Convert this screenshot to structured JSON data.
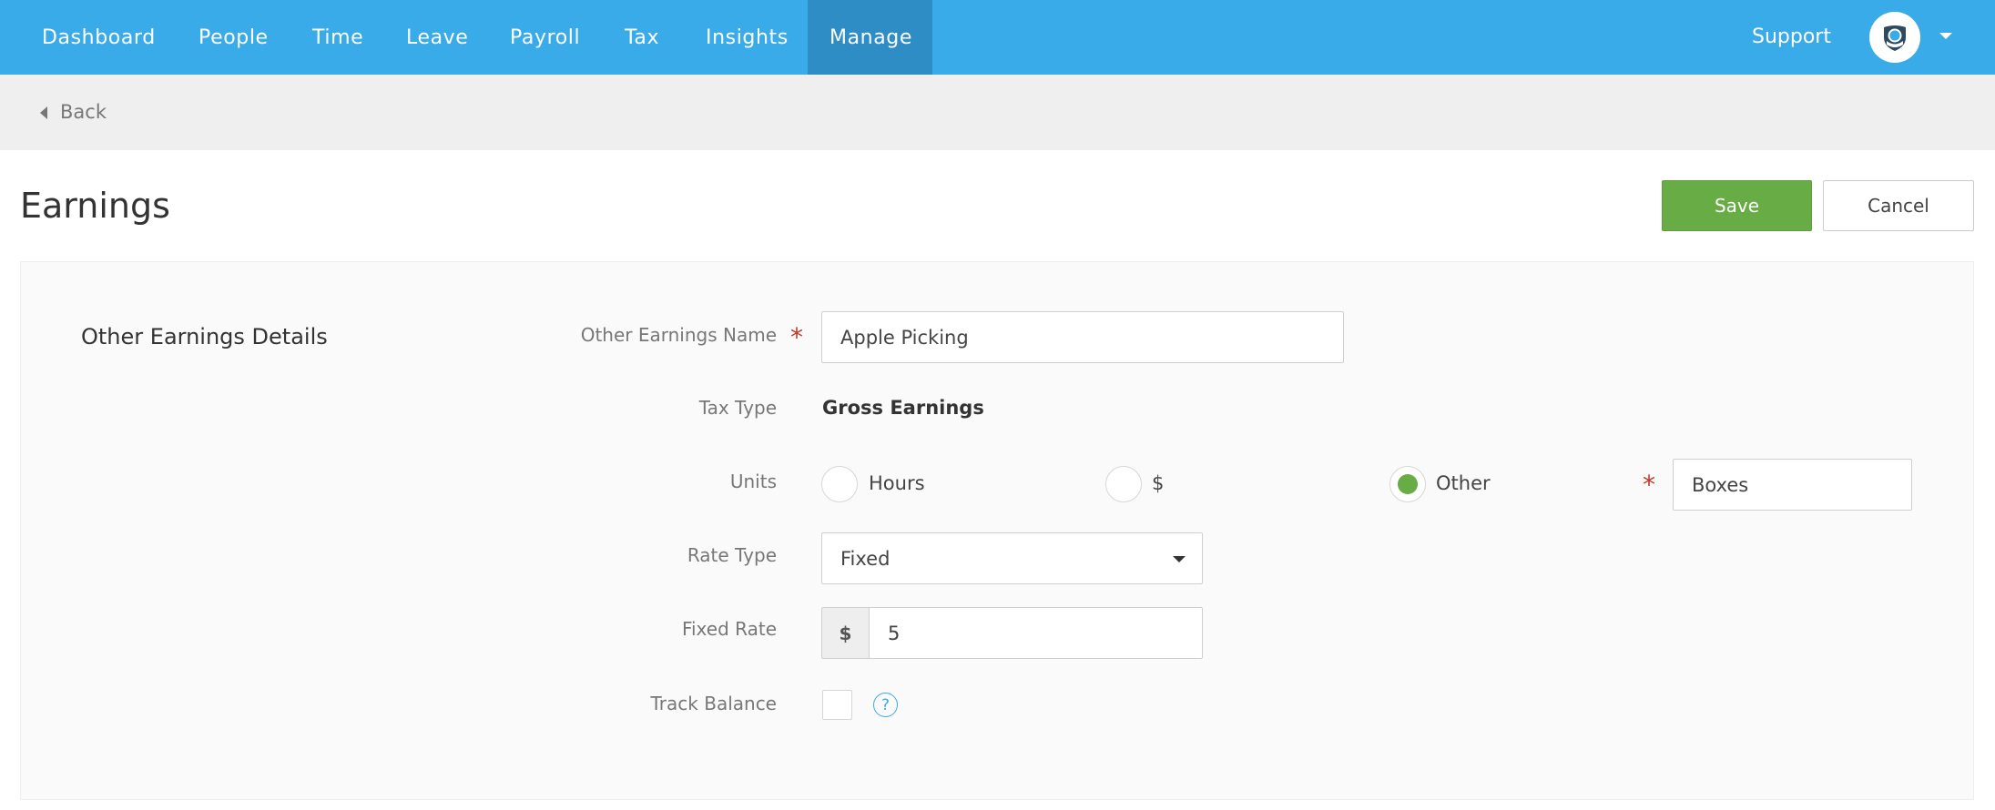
{
  "nav": {
    "items": [
      {
        "label": "Dashboard"
      },
      {
        "label": "People"
      },
      {
        "label": "Time"
      },
      {
        "label": "Leave"
      },
      {
        "label": "Payroll"
      },
      {
        "label": "Tax"
      },
      {
        "label": "Insights"
      },
      {
        "label": "Manage",
        "active": true
      }
    ],
    "support_label": "Support",
    "avatar_icon": "user-shield-icon"
  },
  "subbar": {
    "back_label": "Back"
  },
  "page": {
    "title": "Earnings",
    "save_label": "Save",
    "cancel_label": "Cancel"
  },
  "form": {
    "section_title": "Other Earnings Details",
    "name": {
      "label": "Other Earnings Name",
      "value": "Apple Picking"
    },
    "tax_type": {
      "label": "Tax Type",
      "value": "Gross Earnings"
    },
    "units": {
      "label": "Units",
      "options": [
        {
          "label": "Hours",
          "selected": false
        },
        {
          "label": "$",
          "selected": false
        },
        {
          "label": "Other",
          "selected": true
        }
      ],
      "other_value": "Boxes"
    },
    "rate_type": {
      "label": "Rate Type",
      "value": "Fixed"
    },
    "fixed_rate": {
      "label": "Fixed Rate",
      "addon": "$",
      "value": "5"
    },
    "track_balance": {
      "label": "Track Balance",
      "checked": false,
      "help_glyph": "?"
    }
  },
  "colors": {
    "nav_bg": "#3aabe9",
    "nav_active": "#2f8dc6",
    "save": "#67ac45",
    "required": "#c0392b"
  }
}
